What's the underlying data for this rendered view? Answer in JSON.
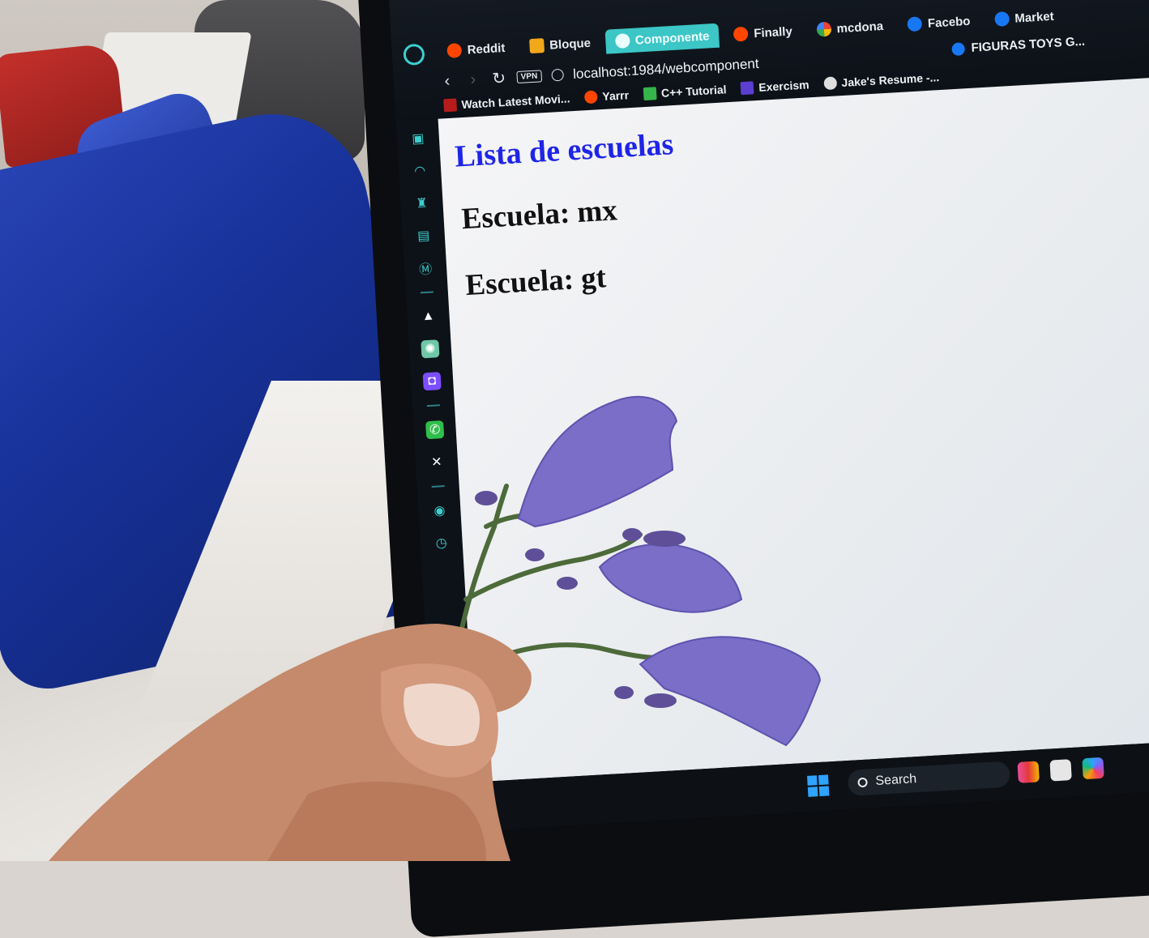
{
  "browser": {
    "tabs": [
      {
        "label": "Reddit",
        "icon": "reddit-icon"
      },
      {
        "label": "Bloque",
        "icon": "bloque-icon"
      },
      {
        "label": "Componente",
        "icon": "component-icon",
        "active": true
      },
      {
        "label": "Finally",
        "icon": "reddit-icon"
      },
      {
        "label": "mcdona",
        "icon": "google-icon"
      },
      {
        "label": "Facebo",
        "icon": "facebook-icon"
      },
      {
        "label": "Market",
        "icon": "facebook-icon"
      }
    ],
    "address": "localhost:1984/webcomponent",
    "vpn_label": "VPN",
    "right_bookmark": "FIGURAS TOYS G...",
    "bookmarks": [
      {
        "label": "Watch Latest Movi...",
        "icon": "movies-icon"
      },
      {
        "label": "Yarrr",
        "icon": "reddit-icon"
      },
      {
        "label": "C++ Tutorial",
        "icon": "cpp-icon"
      },
      {
        "label": "Exercism",
        "icon": "exercism-icon"
      },
      {
        "label": "Jake's Resume -...",
        "icon": "overleaf-icon"
      }
    ]
  },
  "sidebar": {
    "icons": [
      "ai-icon",
      "history-icon",
      "extensions-icon",
      "wallet-icon",
      "chip-icon",
      "aria-icon",
      "chatgpt-icon",
      "messenger-icon",
      "whatsapp-icon",
      "x-icon",
      "spotify-icon",
      "clock-icon"
    ]
  },
  "page": {
    "title": "Lista de escuelas",
    "schools": [
      "Escuela: mx",
      "Escuela: gt"
    ]
  },
  "taskbar": {
    "search_label": "Search"
  },
  "colors": {
    "title_blue": "#1f25e6",
    "accent_teal": "#3cc6c6",
    "flower_purple": "#7b6ec9",
    "chair_blue": "#173199"
  }
}
